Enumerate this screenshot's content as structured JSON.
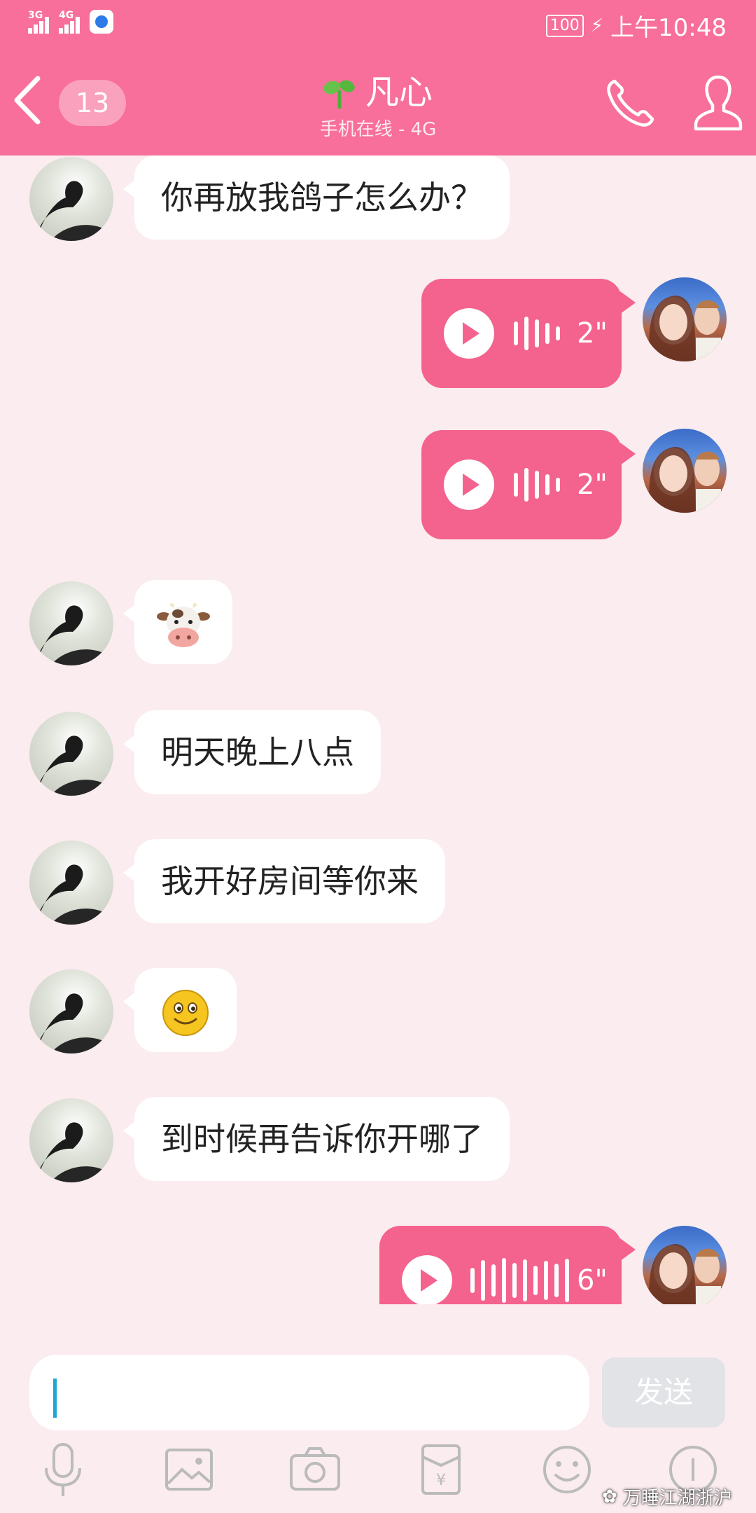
{
  "status_bar": {
    "signal_1": "3G",
    "signal_2": "4G",
    "battery": "100",
    "time": "上午10:48"
  },
  "header": {
    "unread_count": "13",
    "contact_name": "凡心",
    "contact_status": "手机在线 - 4G"
  },
  "messages": [
    {
      "from": "contact",
      "type": "text",
      "text": "你再放我鸽子怎么办？"
    },
    {
      "from": "me",
      "type": "voice",
      "duration": "2\""
    },
    {
      "from": "me",
      "type": "voice",
      "duration": "2\""
    },
    {
      "from": "contact",
      "type": "emoji",
      "emoji": "cow-face"
    },
    {
      "from": "contact",
      "type": "text",
      "text": "明天晚上八点"
    },
    {
      "from": "contact",
      "type": "text",
      "text": "我开好房间等你来"
    },
    {
      "from": "contact",
      "type": "emoji",
      "emoji": "smiley"
    },
    {
      "from": "contact",
      "type": "text",
      "text": "到时候再告诉你开哪了"
    },
    {
      "from": "me",
      "type": "voice",
      "duration": "6\""
    }
  ],
  "input": {
    "value": "",
    "send_label": "发送"
  },
  "toolbar": [
    "microphone-icon",
    "image-icon",
    "camera-icon",
    "red-packet-icon",
    "emoji-icon",
    "plus-icon"
  ],
  "watermark": "万睡江湖浙沪",
  "colors": {
    "header": "#f76f9a",
    "voice_bubble": "#f4628e",
    "background": "#fbecef"
  }
}
